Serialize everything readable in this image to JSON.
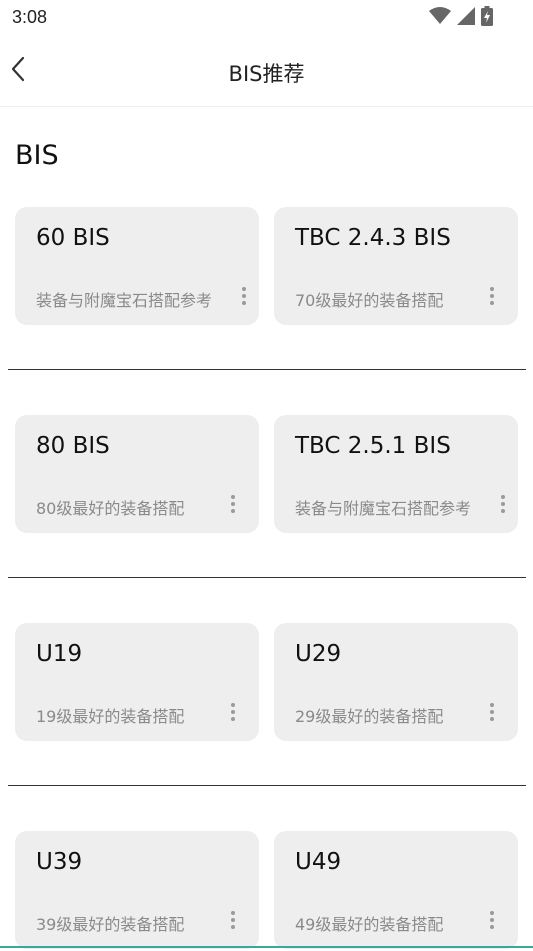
{
  "status_bar": {
    "time": "3:08",
    "icons": [
      "wifi-icon",
      "cell-signal-icon",
      "battery-charging-icon"
    ]
  },
  "app_bar": {
    "back_icon": "chevron-left-icon",
    "title": "BIS推荐"
  },
  "section": {
    "title": "BIS"
  },
  "cards": [
    {
      "title": "60 BIS",
      "subtitle": "装备与附魔宝石搭配参考"
    },
    {
      "title": "TBC 2.4.3 BIS",
      "subtitle": "70级最好的装备搭配"
    },
    {
      "title": "80 BIS",
      "subtitle": "80级最好的装备搭配"
    },
    {
      "title": "TBC 2.5.1 BIS",
      "subtitle": "装备与附魔宝石搭配参考"
    },
    {
      "title": "U19",
      "subtitle": "19级最好的装备搭配"
    },
    {
      "title": "U29",
      "subtitle": "29级最好的装备搭配"
    },
    {
      "title": "U39",
      "subtitle": "39级最好的装备搭配"
    },
    {
      "title": "U49",
      "subtitle": "49级最好的装备搭配"
    }
  ],
  "colors": {
    "card_background": "#eeeeee",
    "subtitle_text": "#8a8a8a",
    "divider": "#333333",
    "accent": "#3aa89a"
  }
}
